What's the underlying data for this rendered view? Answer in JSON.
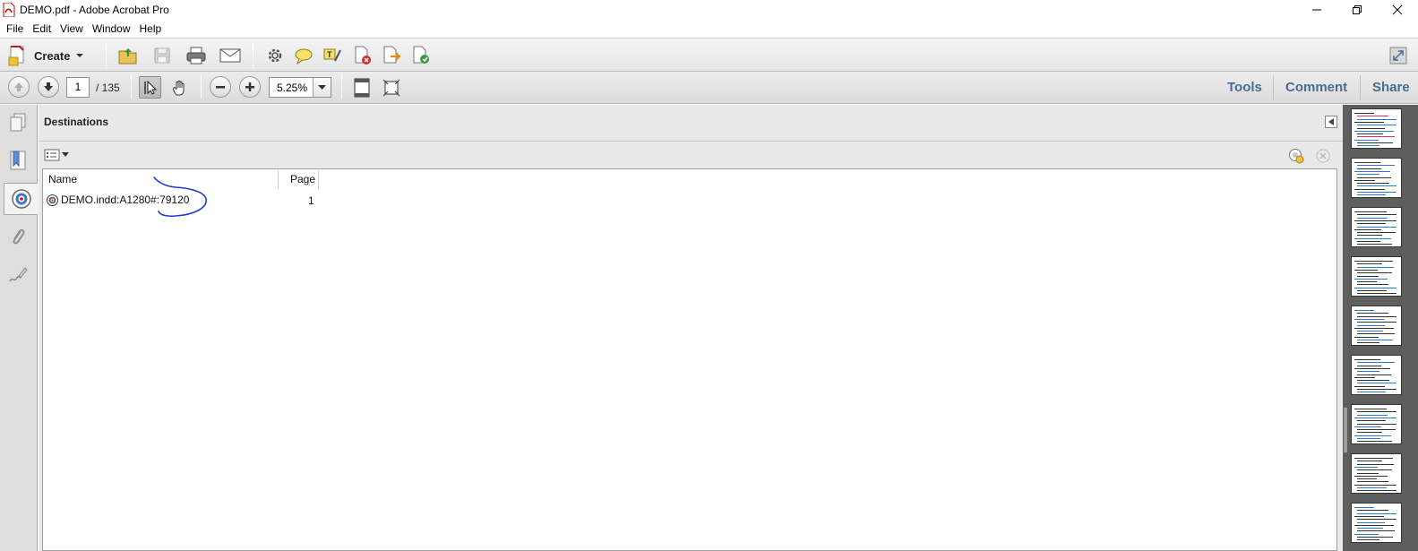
{
  "window": {
    "title": "DEMO.pdf - Adobe Acrobat Pro",
    "controls": [
      "minimize",
      "restore",
      "close"
    ]
  },
  "menu": [
    "File",
    "Edit",
    "View",
    "Window",
    "Help"
  ],
  "toolbar": {
    "create_label": "Create",
    "buttons": [
      "open-icon",
      "save-icon",
      "print-icon",
      "email-icon",
      "gear-icon",
      "comment-icon",
      "highlight-icon",
      "delete-pdf-icon",
      "export-icon",
      "share-icon"
    ]
  },
  "navigation": {
    "current_page": "1",
    "page_total": "/ 135",
    "zoom": "5.25%",
    "right_tabs": {
      "tools": "Tools",
      "comment": "Comment",
      "share": "Share"
    }
  },
  "left_rail": {
    "items": [
      "pages-icon",
      "bookmarks-icon",
      "destinations-icon",
      "attachments-icon",
      "signatures-icon"
    ],
    "active": "destinations-icon"
  },
  "destinations_panel": {
    "title": "Destinations",
    "columns": {
      "name": "Name",
      "page": "Page"
    },
    "rows": [
      {
        "name": "DEMO.indd:A1280#:79120",
        "page": "1"
      }
    ]
  },
  "annotation": {
    "color": "#1f3bd6"
  },
  "thumbnails": {
    "count": 9
  },
  "colors": {
    "tab_text": "#4a6c94",
    "accent_red": "#c8102e"
  }
}
